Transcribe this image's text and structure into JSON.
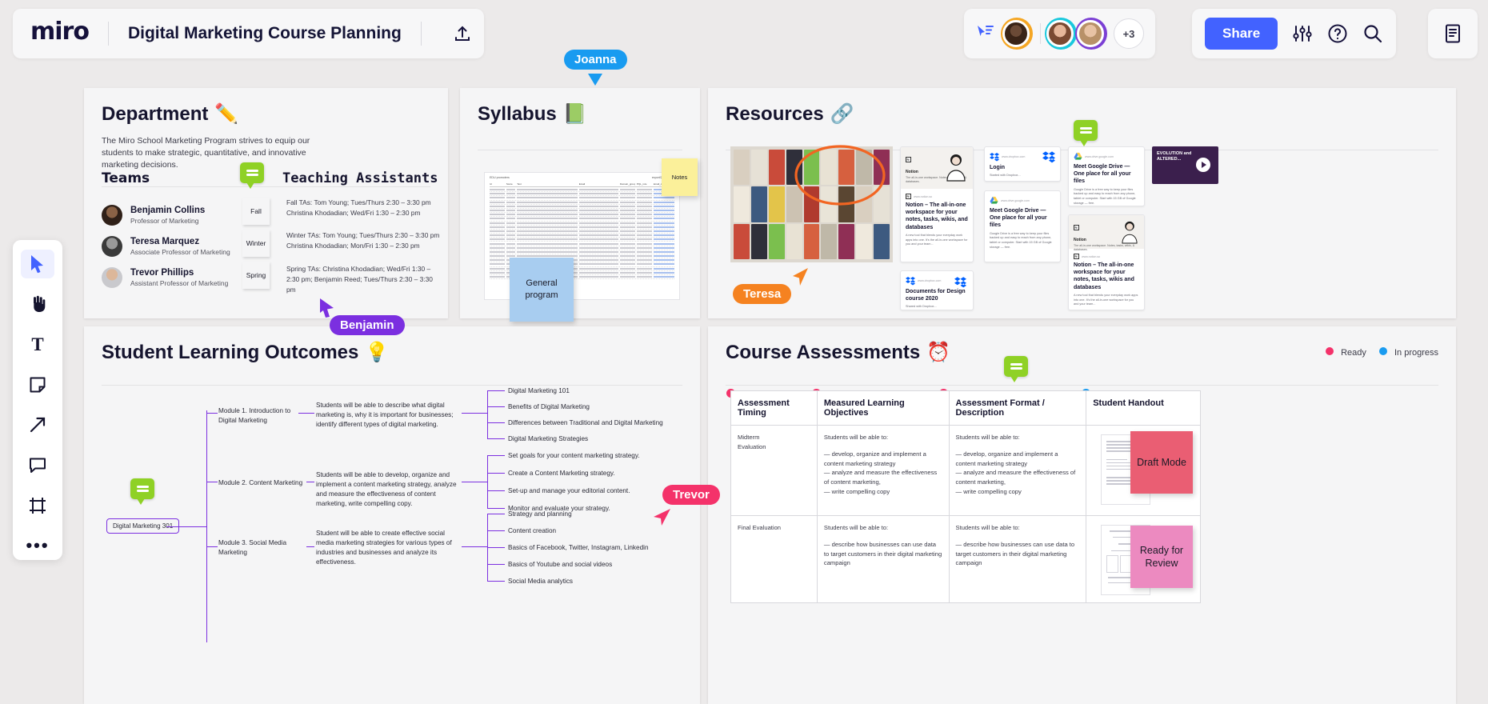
{
  "app": {
    "logo": "miro",
    "board_title": "Digital Marketing Course Planning",
    "upload_icon": "upload-icon"
  },
  "toolbar_right": {
    "cursor_icon": "cursor-share-icon",
    "overflow_count": "+3",
    "share_label": "Share",
    "settings_icon": "sliders-icon",
    "help_icon": "question-circle-icon",
    "search_icon": "search-icon",
    "doc_icon": "document-panel-icon"
  },
  "left_toolbar": {
    "items": [
      {
        "name": "select-tool",
        "glyph": "cursor"
      },
      {
        "name": "hand-tool",
        "glyph": "hand"
      },
      {
        "name": "text-tool",
        "glyph": "T"
      },
      {
        "name": "sticky-note-tool",
        "glyph": "sticky"
      },
      {
        "name": "arrow-tool",
        "glyph": "arrow"
      },
      {
        "name": "comment-tool",
        "glyph": "comment"
      },
      {
        "name": "frame-tool",
        "glyph": "frame"
      },
      {
        "name": "more-tools",
        "glyph": "dots"
      }
    ]
  },
  "department": {
    "title": "Department",
    "title_emoji": "✏️",
    "description": "The Miro School Marketing Program strives to equip our students to make strategic, quantitative, and innovative marketing decisions.",
    "teams_heading": "Teams",
    "teaching_assistants_heading": "Teaching Assistants",
    "people": [
      {
        "name": "Benjamin Collins",
        "role": "Professor of Marketing"
      },
      {
        "name": "Teresa Marquez",
        "role": "Associate Professor of Marketing"
      },
      {
        "name": "Trevor Phillips",
        "role": "Assistant Professor of Marketing"
      }
    ],
    "seasons": [
      {
        "label": "Fall",
        "color": "#a8cdf0"
      },
      {
        "label": "Winter",
        "color": "#cfe265"
      },
      {
        "label": "Spring",
        "color": "#4ecdc4"
      }
    ],
    "ta_notes": [
      "Fall TAs:  Tom Young; Tues/Thurs 2:30 – 3:30 pm Christina Khodadian; Wed/Fri 1:30 – 2:30 pm",
      "Winter TAs:  Tom Young; Tues/Thurs 2:30 – 3:30 pm Christina Khodadian; Mon/Fri 1:30 – 2:30 pm",
      "Spring TAs:  Christina Khodadian; Wed/Fri 1:30 – 2:30 pm; Benjamin Reed; Tues/Thurs 2:30 – 3:30 pm"
    ],
    "comment_icon": "comment-sticker-icon"
  },
  "syllabus": {
    "title": "Syllabus",
    "title_emoji": "📗",
    "doc_header_left": "EDU promoters",
    "doc_header_right": "export/20200512-",
    "doc_columns": [
      "Id",
      "Score",
      "Text",
      "Email",
      "Domain_group",
      "PQL_role",
      "Email_domain"
    ],
    "sticky_notes": "Notes",
    "sticky_general": "General program"
  },
  "resources": {
    "title": "Resources",
    "title_emoji": "🔗",
    "photo_alt": "bookshelf-photo",
    "annotation_shape": "orange-ellipse",
    "cards": [
      {
        "id": "notion-card-1",
        "brand": "Notion",
        "brand_sub": "The all-in-one workspace. Notes, tasks, wikis, & databases.",
        "url": "www.notion.so",
        "title": "Notion – The all-in-one workspace for your notes, tasks, wikis, and databases",
        "desc": "A new tool that blends your everyday work apps into one. It's the all-in-one workspace for you and your team..."
      },
      {
        "id": "dropbox-login-card",
        "url": "www.dropbox.com",
        "title": "Login",
        "desc": "Started with Dropbox..."
      },
      {
        "id": "google-drive-card-1",
        "url": "www.drive.google.com",
        "title": "Meet Google Drive — One place for all your files",
        "desc": "Google Drive is a free way to keep your files backed up and easy to reach from any phone, tablet or computer. Start with 15 GB of Google storage — free."
      },
      {
        "id": "google-drive-card-2",
        "url": "www.drive.google.com",
        "title": "Meet Google Drive — One place for all your files",
        "desc": "Google Drive is a free way to keep your files backed up and easy to reach from any phone, tablet or computer. Start with 15 GB of Google storage — free."
      },
      {
        "id": "dropbox-documents-card",
        "url": "www.dropbox.com",
        "title": "Documents for Design course 2020",
        "desc": "Shared with Dropbox..."
      },
      {
        "id": "notion-card-2",
        "brand": "Notion",
        "brand_sub": "The all-in-one workspace. Notes, tasks, wikis, & databases.",
        "url": "www.notion.so",
        "title": "Notion – The all-in-one workspace for your notes, tasks, wikis and databases",
        "desc": "A new tool that blends your everyday work apps into one. It's the all-in-one workspace for you and your team..."
      },
      {
        "id": "video-card",
        "title": "EVOLUTION and ALTERED...",
        "play_icon": "play-icon"
      }
    ]
  },
  "slo": {
    "title": "Student Learning Outcomes",
    "title_emoji": "💡",
    "root_label": "Digital Marketing 301",
    "comment_icon": "comment-sticker-icon",
    "modules": [
      {
        "label": "Module 1. Introduction to Digital Marketing",
        "outcome": "Students will be able to describe what digital marketing is, why it is important for businesses; identify different types of digital marketing.",
        "topics": [
          "Digital Marketing 101",
          "Benefits of Digital Marketing",
          "Differences between Traditional and Digital Marketing",
          "Digital Marketing Strategies"
        ]
      },
      {
        "label": "Module 2. Content Marketing",
        "outcome": "Students will be able to develop, organize and implement a content marketing strategy, analyze and measure the effectiveness of content marketing, write compelling copy.",
        "topics": [
          "Set goals for your content marketing strategy.",
          "Create a Content Marketing strategy.",
          "Set-up and manage your editorial content.",
          "Monitor and evaluate your strategy."
        ]
      },
      {
        "label": "Module 3. Social Media Marketing",
        "outcome": "Student will be able to create effective social media marketing strategies for various types of industries and businesses  and analyze its effectiveness.",
        "topics": [
          "Strategy and planning",
          "Content creation",
          "Basics of Facebook, Twitter, Instagram, Linkedin",
          "Basics of Youtube and social videos",
          "Social Media analytics"
        ]
      }
    ]
  },
  "assessments": {
    "title": "Course Assessments",
    "title_emoji": "⏰",
    "legend": [
      {
        "label": "Ready",
        "color": "#f4326a"
      },
      {
        "label": "In progress",
        "color": "#199bf0"
      }
    ],
    "comment_icon": "comment-sticker-icon",
    "columns": [
      "Assessment Timing",
      "Measured Learning Objectives",
      "Assessment Format / Description",
      "Student Handout"
    ],
    "rows": [
      {
        "timing": "Midterm\nEvaluation",
        "objectives_intro": "Students will be able to:",
        "objectives": [
          "— develop, organize and implement a content marketing strategy",
          "— analyze and measure the effectiveness of content marketing,",
          "— write compelling copy"
        ],
        "format_intro": "Students will be able to:",
        "format": [
          "— develop, organize and implement a content marketing strategy",
          "— analyze and measure the effectiveness of content marketing,",
          "— write compelling copy"
        ],
        "handout_sticky": "Draft Mode",
        "handout_sticky_color": "#ea5e73"
      },
      {
        "timing": "Final Evaluation",
        "objectives_intro": "Students will be able to:",
        "objectives": [
          "— describe how businesses can use data to target customers in their digital marketing campaign"
        ],
        "format_intro": "Students will be able to:",
        "format": [
          "— describe how businesses can use data to target customers in their digital marketing campaign"
        ],
        "handout_sticky": "Ready for Review",
        "handout_sticky_color": "#ec8ac0"
      }
    ]
  },
  "cursors": [
    {
      "name": "Joanna",
      "color": "#199bf0"
    },
    {
      "name": "Benjamin",
      "color": "#7b2fe0"
    },
    {
      "name": "Teresa",
      "color": "#f58220"
    },
    {
      "name": "Trevor",
      "color": "#f4326a"
    }
  ],
  "colors": {
    "accent_blue": "#4262ff",
    "mindmap_purple": "#7b2fe0",
    "ready": "#f4326a",
    "in_progress": "#199bf0"
  }
}
